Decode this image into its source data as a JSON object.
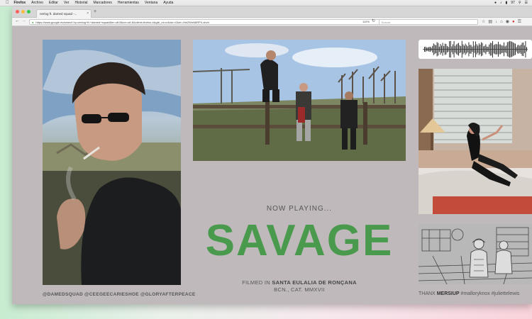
{
  "menubar": {
    "app": "Firefox",
    "items": [
      "Archivo",
      "Editar",
      "Ver",
      "Historial",
      "Marcadores",
      "Herramientas",
      "Ventana",
      "Ayuda"
    ],
    "battery": "97"
  },
  "browser": {
    "tab_title": "nerlog ft. damed squad -...",
    "url": "https://www.google.es/search?q=ceelog+ft.+damed+squad&ie=utf-8&oe=utf-8&client=firefox-b&gfe_rd=cr&dcr=0&ei=Jhb2WnN6RP4-zbvh",
    "search_placeholder": "Buscar",
    "zoom": "110%"
  },
  "page": {
    "now_playing": "NOW PLAYING...",
    "title": "SAVAGE",
    "filmed_prefix": "FILMED IN",
    "filmed_location": "SANTA EULALIA DE RONÇANA",
    "filmed_line2": "BCN., CAT. MMXVII",
    "credits_left": "@DAMEDSQUAD @CEEGEECARIESHOE @GLORYAFTERPEACE",
    "thanx_prefix": "THANX",
    "thanx_name": "MERSIUP",
    "thanx_tags": "#malloryknox #juliettelewis"
  },
  "colors": {
    "title": "#4a9a4e",
    "page_bg": "#bfb9bb"
  }
}
